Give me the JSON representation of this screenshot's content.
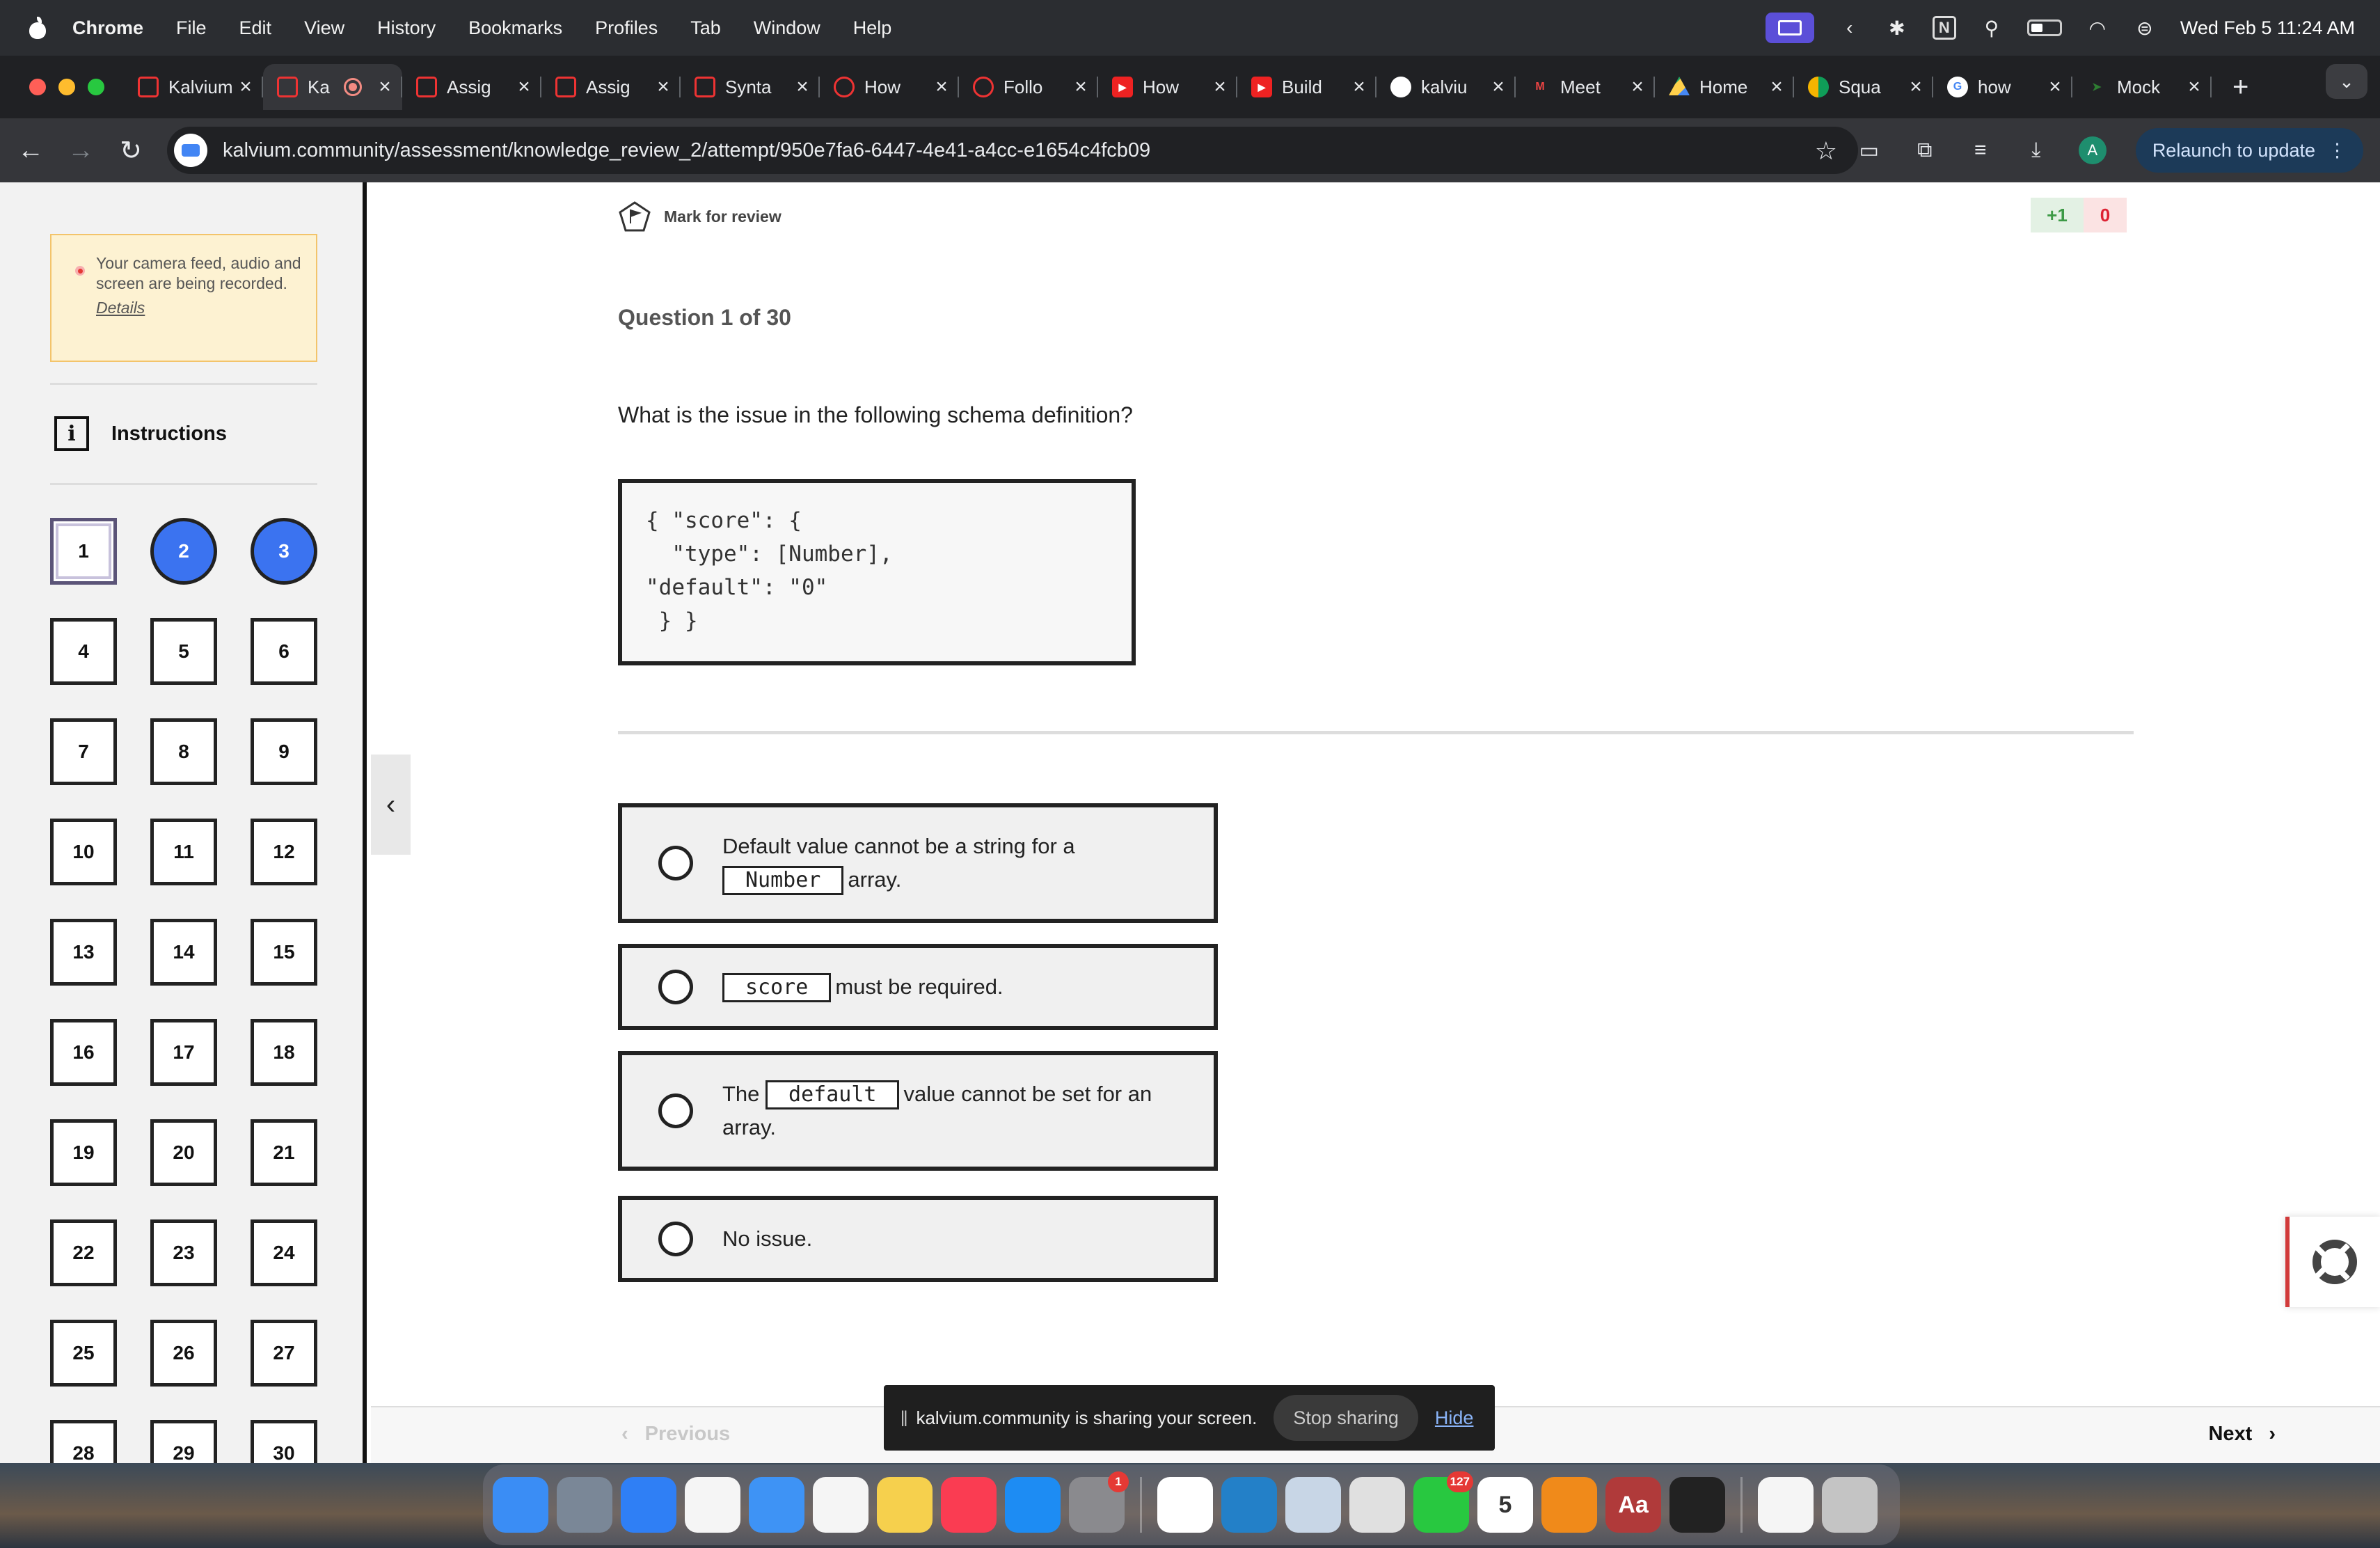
{
  "menubar": {
    "app": "Chrome",
    "items": [
      "File",
      "Edit",
      "View",
      "History",
      "Bookmarks",
      "Profiles",
      "Tab",
      "Window",
      "Help"
    ],
    "clock": "Wed Feb 5  11:24 AM"
  },
  "tabs": [
    {
      "title": "Kalvium",
      "icon": "kalvium-icon"
    },
    {
      "title": "Ka",
      "icon": "kalvium-icon",
      "active": true
    },
    {
      "title": "Assig",
      "icon": "kalvium-icon"
    },
    {
      "title": "Assig",
      "icon": "kalvium-icon"
    },
    {
      "title": "Synta",
      "icon": "kalvium-icon"
    },
    {
      "title": "How",
      "icon": "kalvium-circle-icon"
    },
    {
      "title": "Follo",
      "icon": "kalvium-circle-icon"
    },
    {
      "title": "How",
      "icon": "youtube-icon"
    },
    {
      "title": "Build",
      "icon": "youtube-icon"
    },
    {
      "title": "kalviu",
      "icon": "github-icon"
    },
    {
      "title": "Meet",
      "icon": "gmail-icon"
    },
    {
      "title": "Home",
      "icon": "drive-icon"
    },
    {
      "title": "Squa",
      "icon": "slides-icon"
    },
    {
      "title": "how",
      "icon": "google-icon"
    },
    {
      "title": "Mock",
      "icon": "mock-icon"
    }
  ],
  "toolbar": {
    "url": "kalvium.community/assessment/knowledge_review_2/attempt/950e7fa6-6447-4e41-a4cc-e1654c4fcb09",
    "relaunch_label": "Relaunch to update",
    "avatar_letter": "A"
  },
  "sidebar": {
    "recording_notice": "Your camera feed, audio and screen are being recorded.",
    "details_link": "Details",
    "instructions_label": "Instructions",
    "instructions_icon": "i",
    "questions": [
      {
        "n": "1",
        "state": "current"
      },
      {
        "n": "2",
        "state": "answered"
      },
      {
        "n": "3",
        "state": "answered"
      },
      {
        "n": "4"
      },
      {
        "n": "5"
      },
      {
        "n": "6"
      },
      {
        "n": "7"
      },
      {
        "n": "8"
      },
      {
        "n": "9"
      },
      {
        "n": "10"
      },
      {
        "n": "11"
      },
      {
        "n": "12"
      },
      {
        "n": "13"
      },
      {
        "n": "14"
      },
      {
        "n": "15"
      },
      {
        "n": "16"
      },
      {
        "n": "17"
      },
      {
        "n": "18"
      },
      {
        "n": "19"
      },
      {
        "n": "20"
      },
      {
        "n": "21"
      },
      {
        "n": "22"
      },
      {
        "n": "23"
      },
      {
        "n": "24"
      },
      {
        "n": "25"
      },
      {
        "n": "26"
      },
      {
        "n": "27"
      },
      {
        "n": "28"
      },
      {
        "n": "29"
      },
      {
        "n": "30"
      }
    ]
  },
  "question": {
    "mark_for_review": "Mark for review",
    "score_positive": "+1",
    "score_negative": "0",
    "counter": "Question 1 of 30",
    "text": "What is the issue in the following schema definition?",
    "code": "{ \"score\": {\n  \"type\": [Number],\n\"default\": \"0\"\n } }",
    "options": [
      {
        "before": "Default value cannot be a string for a",
        "code": "Number",
        "after": "array."
      },
      {
        "before": "",
        "code": "score",
        "after": "must be required."
      },
      {
        "before": "The",
        "code": "default",
        "after": "value cannot be set for an array."
      },
      {
        "before": "No issue.",
        "code": "",
        "after": ""
      }
    ]
  },
  "footer": {
    "previous_label": "Previous",
    "next_label": "Next"
  },
  "share_bar": {
    "message": "kalvium.community is sharing your screen.",
    "stop_label": "Stop sharing",
    "hide_label": "Hide"
  },
  "dock": {
    "apps": [
      {
        "name": "finder-icon",
        "color": "#3a8df5"
      },
      {
        "name": "launchpad-icon",
        "color": "#7a8797"
      },
      {
        "name": "safari-icon",
        "color": "#2f7ff5"
      },
      {
        "name": "photos-icon",
        "color": "#f5f5f5"
      },
      {
        "name": "mail-icon",
        "color": "#3e93f5"
      },
      {
        "name": "reminders-icon",
        "color": "#f5f5f5"
      },
      {
        "name": "notes-icon",
        "color": "#f6d04d"
      },
      {
        "name": "music-icon",
        "color": "#fa3c52"
      },
      {
        "name": "app-store-icon",
        "color": "#1d8cf3"
      },
      {
        "name": "settings-icon",
        "color": "#8a8a8e",
        "badge": "1"
      },
      {
        "name": "notion-icon",
        "color": "#ffffff"
      },
      {
        "name": "vscode-icon",
        "color": "#2380c8"
      },
      {
        "name": "preview-icon",
        "color": "#c8d6e6"
      },
      {
        "name": "chrome-icon",
        "color": "#e0e0e0"
      },
      {
        "name": "whatsapp-icon",
        "color": "#28c840",
        "badge": "127"
      },
      {
        "name": "calendar-icon",
        "color": "#ffffff",
        "label": "5"
      },
      {
        "name": "vlc-icon",
        "color": "#f08a1a"
      },
      {
        "name": "dictionary-icon",
        "color": "#b03a3a",
        "label": "Aa"
      },
      {
        "name": "terminal-icon",
        "color": "#222222"
      },
      {
        "name": "document-icon",
        "color": "#f5f5f5"
      },
      {
        "name": "trash-icon",
        "color": "#c4c4c4"
      }
    ]
  }
}
